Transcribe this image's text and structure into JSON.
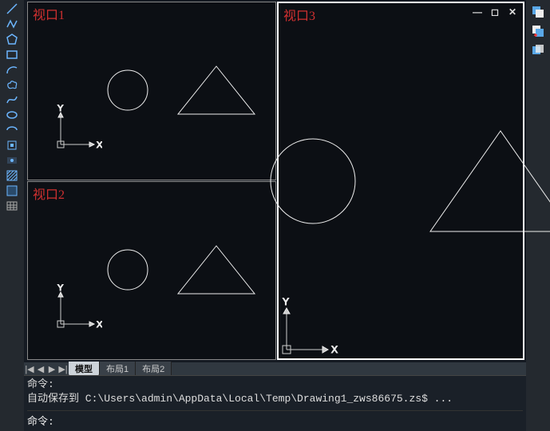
{
  "viewports": {
    "vp1": {
      "label": "视口1"
    },
    "vp2": {
      "label": "视口2"
    },
    "vp3": {
      "label": "视口3"
    }
  },
  "axes": {
    "x": "X",
    "y": "Y"
  },
  "window_controls": {
    "min": "—",
    "max": "◻",
    "close": "✕"
  },
  "tabs": {
    "model": "模型",
    "layout1": "布局1",
    "layout2": "布局2"
  },
  "command": {
    "hist1": "命令:",
    "hist2": "自动保存到 C:\\Users\\admin\\AppData\\Local\\Temp\\Drawing1_zws86675.zs$ ...",
    "prompt": "命令:",
    "input_value": ""
  },
  "left_tools": [
    "line",
    "polyline",
    "polygon",
    "rectangle",
    "arc",
    "revcloud",
    "spline",
    "ellipse",
    "ellipse-arc",
    "block",
    "point",
    "hatch",
    "region",
    "table"
  ],
  "right_tools": [
    "layer-overlay",
    "layer-swap",
    "layer-merge"
  ],
  "nav": {
    "first": "|◀",
    "prev": "◀",
    "next": "▶",
    "last": "▶|"
  }
}
